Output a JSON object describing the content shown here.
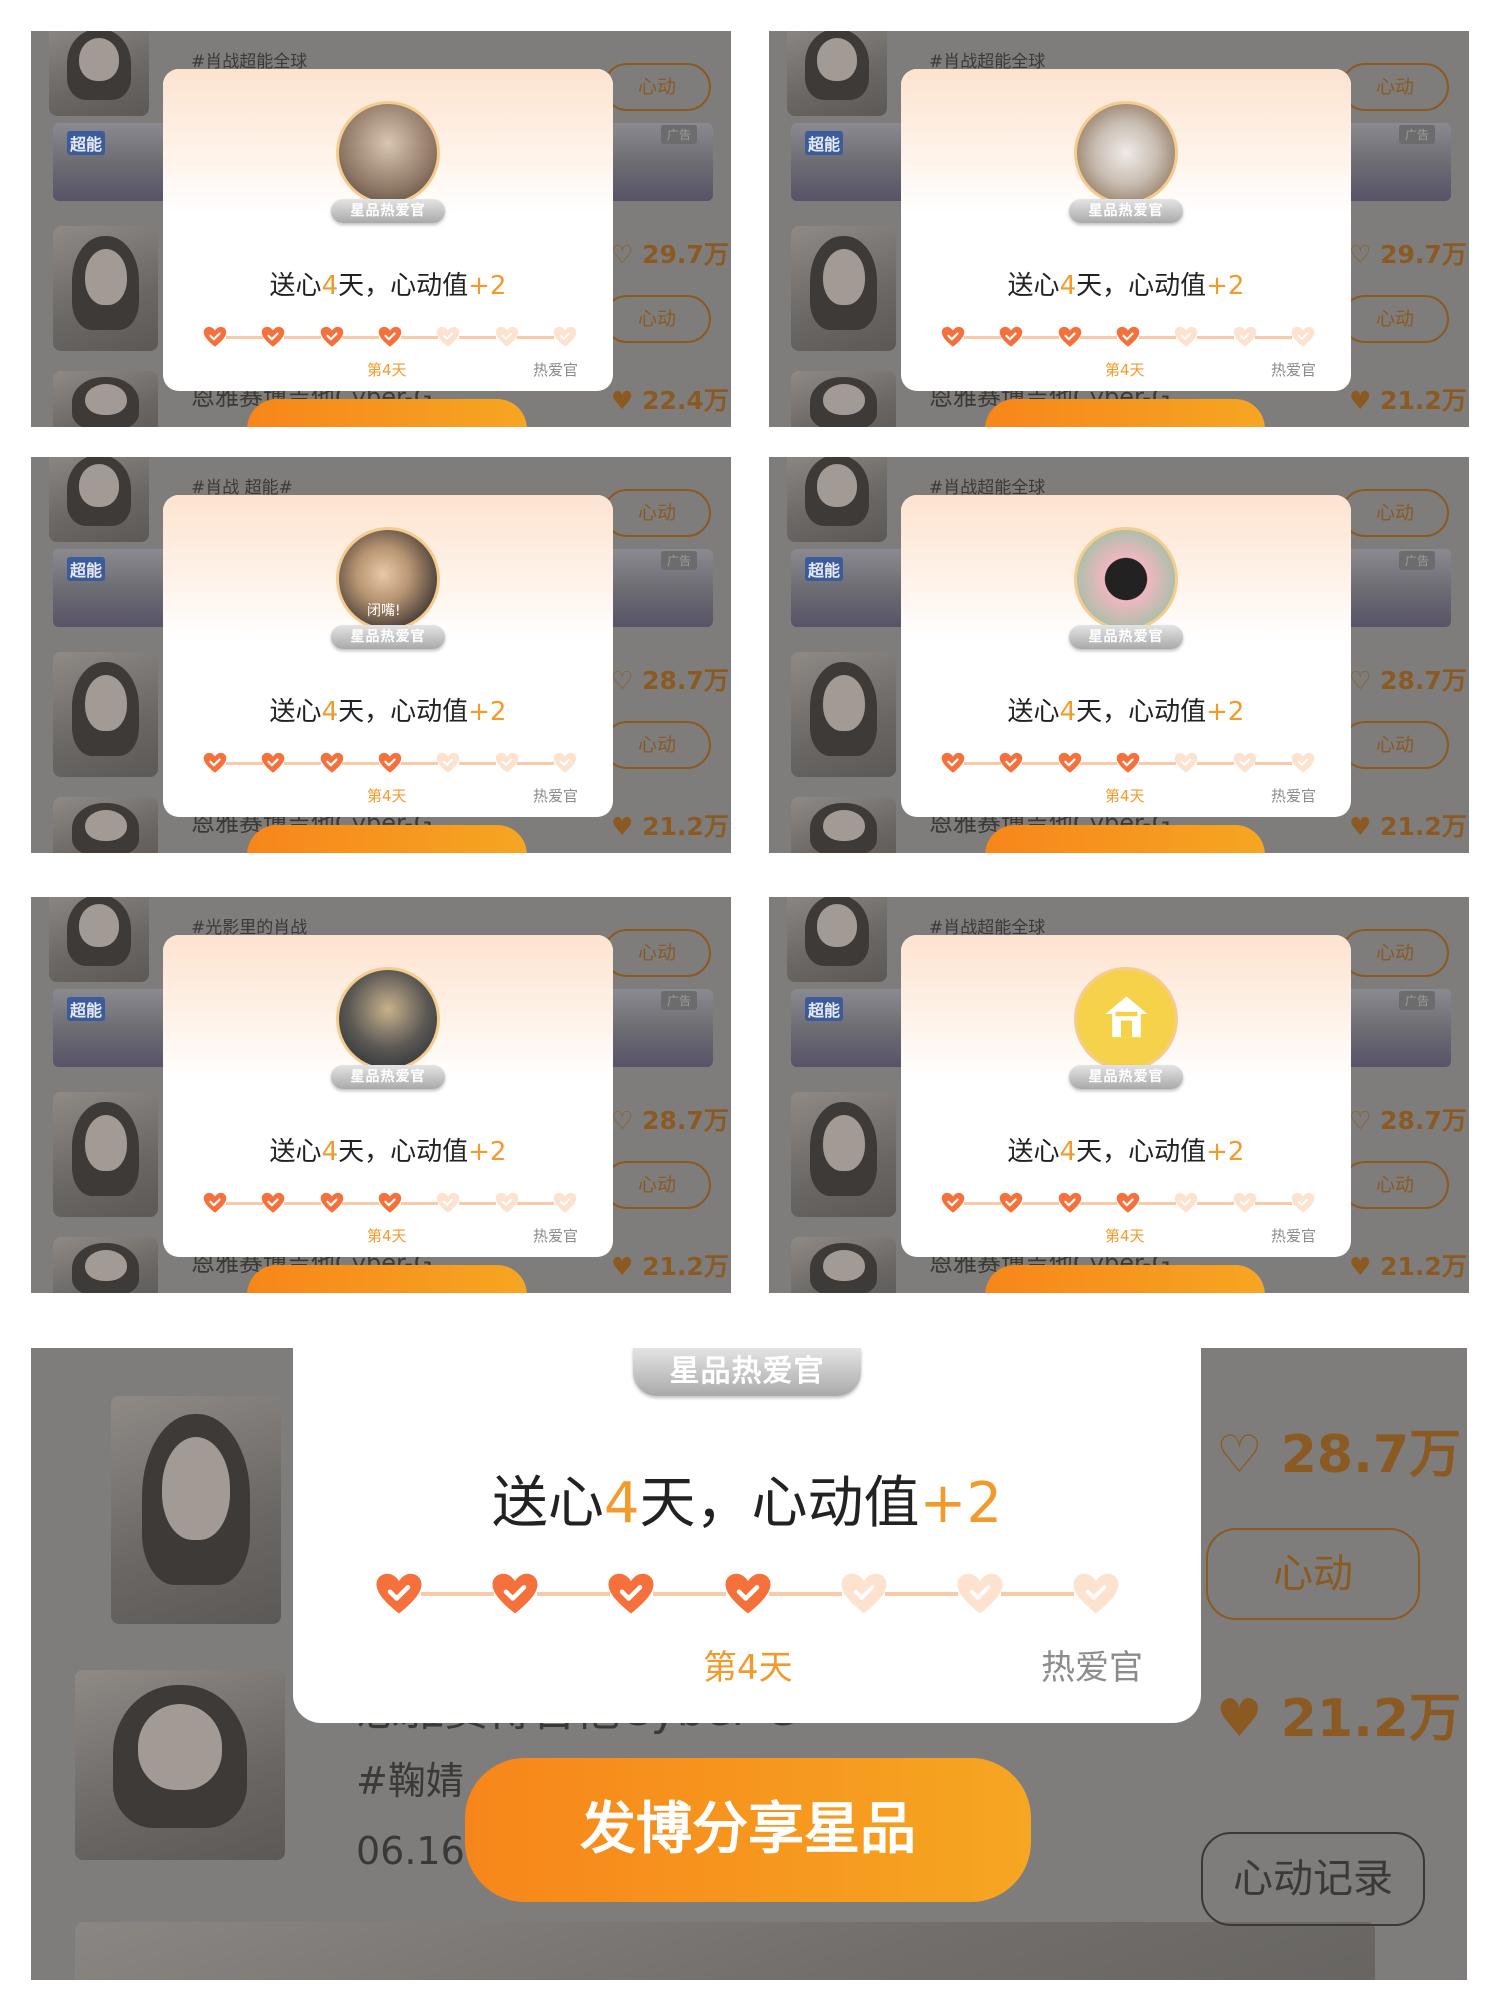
{
  "popup": {
    "badge": "星品热爱官",
    "msg_prefix": "送心",
    "days": "4",
    "msg_mid": "天，心动值",
    "points": "+2",
    "day_label": "第4天",
    "final_label": "热爱官",
    "hearts_filled": 4,
    "hearts_total": 7
  },
  "background": {
    "hashtag_1": "#肖战超能全球",
    "hashtag_2": "#肖战 超能#",
    "hashtag_3": "#光影里的肖战",
    "ad_logo": "超能",
    "ad_tag": "广告",
    "cheer_button": "心动",
    "count_1": "29.7万",
    "count_2": "28.7万",
    "count_3": "22.4万",
    "count_4": "21.2万",
    "product_title": "恩雅赛博吉他Cyber-G",
    "hashtag_product": "#鞠婧",
    "date": "06.16 官宣",
    "share_button": "发博分享星品",
    "record_button": "心动记录"
  },
  "avatars": [
    "cap-girl-selfie-avatar",
    "white-kitten-avatar",
    "bread-closed-mouth-avatar",
    "cartoon-girl-flower-avatar",
    "night-walk-girl-avatar",
    "yellow-house-icon-avatar"
  ],
  "avatar_caption_3": "闭嘴!",
  "colors": {
    "accent": "#f39a2c",
    "heart_filled": "#f5703a",
    "heart_empty": "#fde3cf",
    "button": "#f7861a"
  }
}
